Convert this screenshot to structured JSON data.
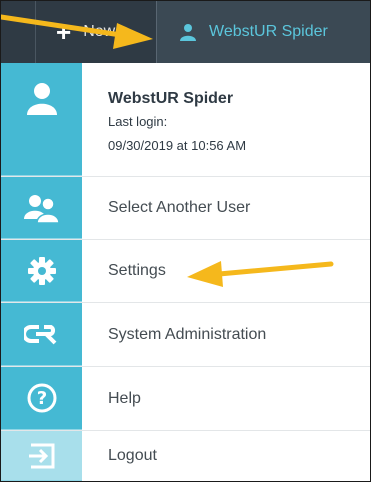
{
  "topbar": {
    "new_label": "New",
    "user_name": "WebstUR Spider"
  },
  "profile": {
    "name": "WebstUR Spider",
    "last_login_label": "Last login:",
    "last_login_value": "09/30/2019 at 10:56 AM"
  },
  "menu": {
    "items": [
      {
        "label": "Select Another User",
        "icon": "users-icon"
      },
      {
        "label": "Settings",
        "icon": "gear-icon"
      },
      {
        "label": "System Administration",
        "icon": "cr-logo-icon"
      },
      {
        "label": "Help",
        "icon": "help-icon"
      },
      {
        "label": "Logout",
        "icon": "logout-icon"
      }
    ]
  },
  "colors": {
    "topbar": "#2f3a44",
    "rail": "#45b9d3",
    "accent_text": "#5bc6dc",
    "annotation_arrow": "#f5b81c"
  }
}
